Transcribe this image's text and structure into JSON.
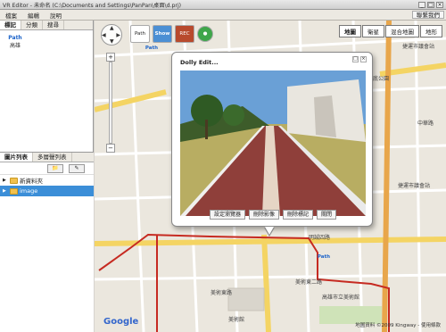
{
  "window": {
    "title": "VR Editor - 未命名 (C:\\Documents and Settings\\PanPan\\桌面\\d.prj)"
  },
  "menu": {
    "items": [
      "檔案",
      "編輯",
      "說明"
    ],
    "right": "聯繫我們"
  },
  "left_tabs": [
    "標記",
    "分類",
    "搜尋"
  ],
  "mark": {
    "logo": "Path",
    "label": "高雄"
  },
  "lower_tabs": [
    "圖片列表",
    "多層聲列表"
  ],
  "tree": [
    {
      "label": "新資料夾",
      "selected": false
    },
    {
      "label": "image",
      "selected": true
    }
  ],
  "map_types": [
    "地圖",
    "衛星",
    "混合地圖",
    "地形"
  ],
  "icons": {
    "path": "Path",
    "show": "Show",
    "rec": "REC"
  },
  "popup": {
    "title": "Dolly Edit...",
    "actions": [
      "設定瀏覽器",
      "刪除影像",
      "刪除標記",
      "關閉"
    ]
  },
  "map": {
    "google": "Google",
    "copyright": "地圖資料 ©2009 Kingway - 使用條款",
    "labels": [
      "捷運市議會站",
      "明誠四路",
      "美術東二路",
      "美術館",
      "捷運市議會站",
      "高雄市立美術館",
      "美術東路",
      "中華路",
      "凹子底公園"
    ]
  }
}
